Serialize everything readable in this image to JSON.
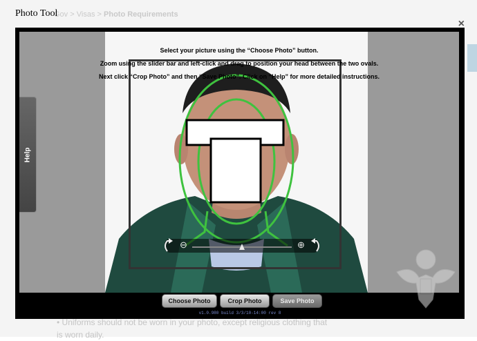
{
  "background": {
    "breadcrumb_prefix": "Gov",
    "breadcrumb_sep1": ">",
    "breadcrumb_mid": "Visas",
    "breadcrumb_sep2": ">",
    "breadcrumb_current": "Photo Requirements",
    "bullet_text": "Uniforms should not be worn in your photo, except religious clothing that is worn daily."
  },
  "dialog": {
    "title": "Photo Tool",
    "close_label": "×"
  },
  "instructions": {
    "line1": "Select your picture using the “Choose Photo” button.",
    "line2": "Zoom using the slider bar and left-click and drag to position your head between the two ovals.",
    "line3": "Next click “Crop Photo” and then “Save Photo”.  Click on “Help” for more detailed instructions."
  },
  "help_tab": {
    "label": "Help"
  },
  "slider": {
    "minus_label": "⊖",
    "plus_label": "⊕",
    "zoom_position": 0.5
  },
  "buttons": {
    "choose": "Choose Photo",
    "crop": "Crop Photo",
    "save": "Save Photo"
  },
  "version": "v1.0.980 build 3/3/10-14:00 rev 8",
  "icons": {
    "rotate_left": "rotate-left-icon",
    "rotate_right": "rotate-right-icon",
    "seal": "great-seal-icon"
  },
  "colors": {
    "guide_green": "#3fc23f",
    "frame_black": "#000000",
    "canvas_gray": "#9a9a9a"
  }
}
